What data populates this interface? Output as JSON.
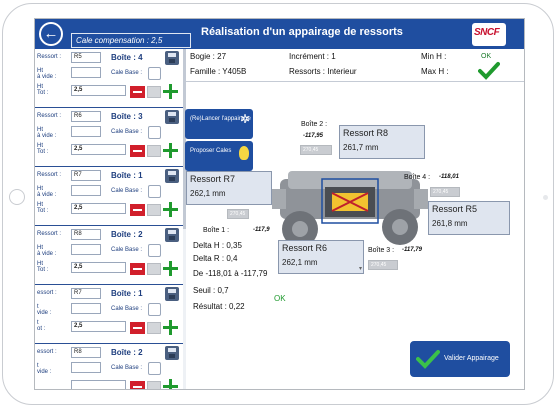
{
  "header": {
    "back_icon": "arrow-left-icon",
    "cale_compensation": "Cale compensation : 2,5",
    "title": "Réalisation d'un appairage de ressorts",
    "logo": "SNCF",
    "accent": "#1f4ea0"
  },
  "info": {
    "bogie": "Bogie : 27",
    "famille": "Famille : Y405B",
    "increment": "Incrément : 1",
    "ressorts": "Ressorts : Interieur",
    "min_h": "Min H :",
    "max_h": "Max H :",
    "ok_top": "OK"
  },
  "buttons": {
    "relancer": "(Re)Lancer l'appairage",
    "proposer": "Proposer Cales",
    "valider": "Valider Appairage"
  },
  "left_groups": [
    {
      "ressort_label": "Ressort :",
      "ressort": "R5",
      "boite": "Boîte : 4",
      "ht_vide": "Ht\nà vide :",
      "cale_base": "Cale Base :",
      "ht_tot": "Ht\nTot :",
      "tot_value": "2,5"
    },
    {
      "ressort_label": "Ressort :",
      "ressort": "R6",
      "boite": "Boîte : 3",
      "ht_vide": "Ht\nà vide :",
      "cale_base": "Cale Base :",
      "ht_tot": "Ht\nTot :",
      "tot_value": "2,5"
    },
    {
      "ressort_label": "Ressort :",
      "ressort": "R7",
      "boite": "Boîte : 1",
      "ht_vide": "Ht\nà vide :",
      "cale_base": "Cale Base :",
      "ht_tot": "Ht\nTot :",
      "tot_value": "2,5"
    },
    {
      "ressort_label": "Ressort :",
      "ressort": "R8",
      "boite": "Boîte : 2",
      "ht_vide": "Ht\nà vide :",
      "cale_base": "Cale Base :",
      "ht_tot": "Ht\nTot :",
      "tot_value": "2,5"
    },
    {
      "ressort_label": "essort :",
      "ressort": "R7",
      "boite": "Boîte : 1",
      "ht_vide": "t\nvide :",
      "cale_base": "Cale Base :",
      "ht_tot": "t\not :",
      "tot_value": "2,5"
    },
    {
      "ressort_label": "essort :",
      "ressort": "R8",
      "boite": "Boîte : 2",
      "ht_vide": "t\nvide :",
      "cale_base": "Cale Base :",
      "ht_tot": "",
      "tot_value": ""
    }
  ],
  "springs": {
    "r8": {
      "name": "Ressort R8",
      "value": "261,7 mm"
    },
    "r7": {
      "name": "Ressort R7",
      "value": "262,1 mm"
    },
    "r5": {
      "name": "Ressort R5",
      "value": "261,8 mm"
    },
    "r6": {
      "name": "Ressort R6",
      "value": "262,1 mm"
    }
  },
  "boites": {
    "b2": {
      "label": "Boîte 2 :",
      "coord": "-117,95"
    },
    "b4": {
      "label": "Boîte 4 :",
      "coord": "-118,01"
    },
    "b1": {
      "label": "Boîte 1 :",
      "coord": "-117,9"
    },
    "b3": {
      "label": "Boîte 3 :",
      "coord": "-117,79"
    }
  },
  "results": {
    "delta_h": "Delta H : 0,35",
    "delta_r": "Delta R :  0,4",
    "de": "De -118,01 à -117,79",
    "seuil": "Seuil :        0,7",
    "resultat": "Résultat : 0,22",
    "ok": "OK"
  },
  "gray_fields": {
    "g1": "270,45",
    "g2": "270,45",
    "g3": "270,45",
    "g4": "270,45"
  }
}
